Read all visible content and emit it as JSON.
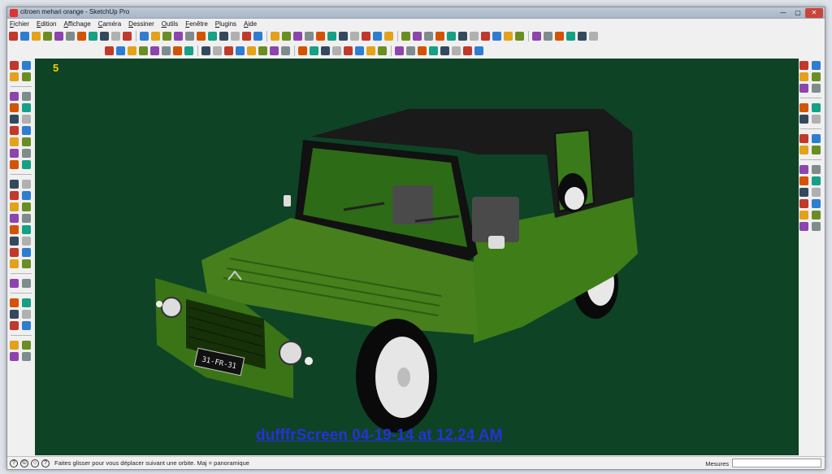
{
  "window": {
    "title": "citroen mehari orange - SketchUp Pro",
    "minimize": "—",
    "maximize": "▢",
    "close": "✕"
  },
  "menu": [
    "Fichier",
    "Edition",
    "Affichage",
    "Caméra",
    "Dessiner",
    "Outils",
    "Fenêtre",
    "Plugins",
    "Aide"
  ],
  "viewport": {
    "scene_counter": "5",
    "watermark": "dufffrScreen 04-19-14 at 12.24 AM",
    "license_plate": "31-FR-31",
    "background_color": "#0e4326",
    "body_color": "#3e7d18",
    "roof_color": "#1a1a1a"
  },
  "toolbar_top_row1": [
    "select",
    "pencil",
    "rectangle",
    "circle",
    "arc",
    "eraser-alt",
    "eraser",
    "paint",
    "push-pull",
    "move",
    "rotate",
    "follow-me",
    "scale",
    "offset",
    "tape",
    "protractor",
    "text",
    "axes",
    "dimension",
    "section",
    "zoom",
    "orbit",
    "pan",
    "zoom-window",
    "zoom-extents",
    "iso",
    "top",
    "front",
    "right",
    "back",
    "left",
    "bottom",
    "xray",
    "wireframe",
    "hidden-line",
    "shaded",
    "textured",
    "monochrome",
    "shadows",
    "fog",
    "edges",
    "components",
    "groups",
    "styles",
    "layers",
    "outliner",
    "scenes",
    "materials",
    "entity-info",
    "ruby"
  ],
  "toolbar_top_row2": [
    "plugin-1",
    "plugin-2",
    "plugin-3",
    "plugin-4",
    "plugin-5",
    "plugin-6",
    "plugin-7",
    "plugin-8",
    "plugin-9",
    "plugin-10",
    "plugin-11",
    "plugin-12",
    "plugin-13",
    "plugin-14",
    "plugin-15",
    "plugin-16",
    "plugin-17",
    "plugin-18",
    "plugin-19",
    "plugin-20",
    "plugin-21",
    "grid",
    "sandbox-1",
    "sandbox-2",
    "sandbox-3",
    "sandbox-4",
    "sandbox-5",
    "sandbox-6",
    "sandbox-7",
    "sandbox-8",
    "sandbox-9",
    "sandbox-10"
  ],
  "status": {
    "message": "Faites glisser pour vous déplacer suivant une orbite.  Maj = panoramique",
    "measure_label": "Mesures",
    "icons": [
      "geo-location-icon",
      "credits-icon",
      "help-icon",
      "info-icon"
    ]
  }
}
